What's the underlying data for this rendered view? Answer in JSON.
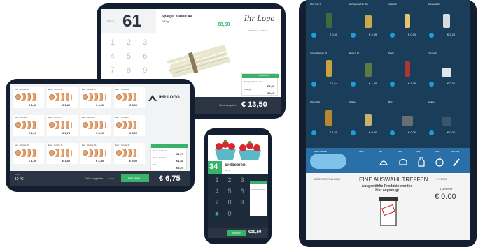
{
  "colors": {
    "bezel": "#131f30",
    "accent_green": "#39b36a",
    "dark_blue": "#1a3d5a",
    "badge_blue": "#1a9fdc"
  },
  "tablet_asparagus": {
    "unit_label": "PACK",
    "quantity": "61",
    "product_name": "Spargel Klasse AA",
    "product_sub": "700 gr",
    "price": "€8,50",
    "logo_text": "Ihr Logo",
    "logo_sub": "Hofladen & Feinkost",
    "keypad": [
      "1",
      "2",
      "3",
      "4",
      "5",
      "6",
      "7",
      "8",
      "9"
    ],
    "cart_header": "Warenkorb",
    "cart_lines": [
      {
        "label": "Spargel Klasse AA",
        "price": "€8,50"
      },
      {
        "label": "Spargel",
        "price": "€5,00"
      }
    ],
    "pay_label": "Geld eingeben",
    "total": "€ 13,50"
  },
  "tablet_eggs": {
    "products": [
      {
        "name": "Eier - Größe M",
        "price": "€ 1,80"
      },
      {
        "name": "Eier - Größe M",
        "price": "€ 1,80"
      },
      {
        "name": "Eier - Größe M",
        "price": "€ 4,60"
      },
      {
        "name": "Eier - Größe M",
        "price": "€ 8,00"
      },
      {
        "name": "Eier - Größe L",
        "price": "€ 1,20"
      },
      {
        "name": "Eier - Größe L",
        "price": "€ 1,75"
      },
      {
        "name": "Eier - Größe L",
        "price": "€ 5,00"
      },
      {
        "name": "Eier - Größe L",
        "price": "€ 8,00"
      },
      {
        "name": "Eier - Größe XL",
        "price": "€ 1,30"
      },
      {
        "name": "Eier - Größe XL",
        "price": "€ 1,80"
      },
      {
        "name": "Eier - Größe XL",
        "price": "€ 4,80"
      },
      {
        "name": "Eier - Größe XL",
        "price": "€ 9,00"
      }
    ],
    "logo_text": "IHR LOGO",
    "cart_lines": [
      {
        "label": "Eier - Größe M",
        "price": "€1,70"
      },
      {
        "label": "Eier - Größe L",
        "price": "€1,80"
      },
      {
        "label": "Eier",
        "price": "€3,25"
      }
    ],
    "temp_label": "Temp.",
    "temp_value": "10 °C",
    "pay_label": "Geld eingeben",
    "pay_hint": "oder",
    "pay_button": "Karte zahlen",
    "total": "€ 6,75"
  },
  "phone_strawberries": {
    "quantity": "34",
    "product_name": "Erdbeeren",
    "product_sub": "250 gr",
    "keypad": [
      "1",
      "2",
      "3",
      "4",
      "5",
      "6",
      "7",
      "8",
      "9",
      "0"
    ],
    "start_button": "STARTEN",
    "total": "€10,50"
  },
  "tablet_vending": {
    "rows": [
      [
        {
          "name": "Obst Saft 1l",
          "price": "€ 0,00"
        },
        {
          "name": "Handgemachter Tee",
          "price": "€ 2,59"
        },
        {
          "name": "Apfelsaft",
          "price": "€ 0,00"
        },
        {
          "name": "Orangensaft",
          "price": "€ 2,29"
        }
      ],
      [
        {
          "name": "Sonnenblumen Öl",
          "price": "€ 1,64"
        },
        {
          "name": "Essig & Öl",
          "price": "€ 1,89"
        },
        {
          "name": "Pesto",
          "price": "€ 1,39"
        },
        {
          "name": "Thunfisch",
          "price": "€ 2,36"
        }
      ],
      [
        {
          "name": "Olivenöl 1l",
          "price": "€ 1,56"
        },
        {
          "name": "Kräuter",
          "price": "€ 0,00"
        },
        {
          "name": "Brot",
          "price": "€ 0,00"
        },
        {
          "name": "Nudeln",
          "price": "€ 0,00"
        }
      ]
    ],
    "categories": [
      "Alle Produkte",
      "Milch",
      "Eier",
      "Brot",
      "Saft",
      "Obst",
      "Gemüse"
    ],
    "cart_label": "IHRE BESTELLUNG",
    "headline": "EINE AUSWAHL TREFFEN",
    "subline": "Ausgewählte Produkte werden hier angezeigt",
    "items_label": "0 ITEMS",
    "total_label": "Gesamt",
    "total": "€ 0.00"
  }
}
